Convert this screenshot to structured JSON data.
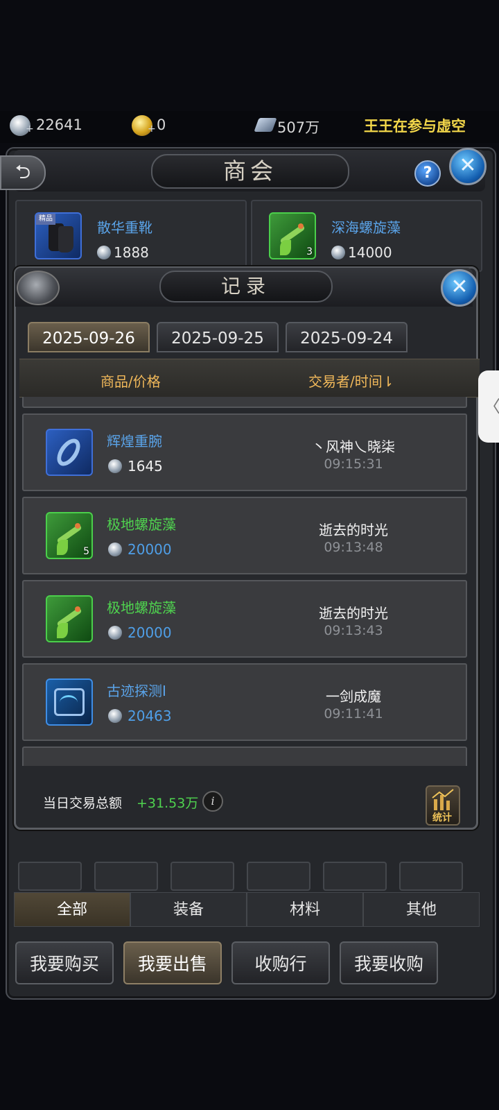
{
  "currency": {
    "silver": "22641",
    "gold": "0",
    "crystal": "507万",
    "marquee": "王王在参与虚空"
  },
  "main": {
    "title": "商会",
    "back_icon": "back-arrow-icon",
    "help": "?",
    "close": "✕",
    "listings": [
      {
        "name": "散华重靴",
        "price": "1888",
        "icon": "boots-icon",
        "tag": "精品"
      },
      {
        "name": "深海螺旋藻",
        "price": "14000",
        "icon": "herb-icon",
        "count": "3"
      }
    ],
    "filters": [
      "全部",
      "装备",
      "材料",
      "其他"
    ],
    "active_filter": 0,
    "bottom_buttons": [
      "我要购买",
      "我要出售",
      "收购行",
      "我要收购"
    ],
    "active_bottom": 1
  },
  "record": {
    "title": "记录",
    "close": "✕",
    "tabs": [
      "2025-09-26",
      "2025-09-25",
      "2025-09-24"
    ],
    "active_tab": 0,
    "col_item": "商品/价格",
    "col_trader": "交易者/时间⇂",
    "rows": [
      {
        "name": "辉煌重腕",
        "name_color": "#5aa3e8",
        "price": "1645",
        "price_color": "#f0f0f0",
        "icon": "bracer-icon",
        "count": "",
        "trader": "丶风神乀晓柒",
        "time": "09:15:31"
      },
      {
        "name": "极地螺旋藻",
        "name_color": "#4fd34f",
        "price": "20000",
        "price_color": "#4f9fe8",
        "icon": "herb-icon",
        "count": "5",
        "trader": "逝去的时光",
        "time": "09:13:48"
      },
      {
        "name": "极地螺旋藻",
        "name_color": "#4fd34f",
        "price": "20000",
        "price_color": "#4f9fe8",
        "icon": "herb-icon",
        "count": "",
        "trader": "逝去的时光",
        "time": "09:13:43"
      },
      {
        "name": "古迹探测Ⅰ",
        "name_color": "#5aa3e8",
        "price": "20463",
        "price_color": "#4f9fe8",
        "icon": "scanner-icon",
        "count": "",
        "trader": "一剑成魔",
        "time": "09:11:41"
      }
    ],
    "summary_label": "当日交易总额",
    "summary_value": "+31.53万",
    "info": "i",
    "stats_label": "统计"
  },
  "side_tab": "〈",
  "colors": {
    "accent_gold": "#f0b85a",
    "green_gain": "#4fd34f",
    "blue_name": "#5aa3e8"
  }
}
